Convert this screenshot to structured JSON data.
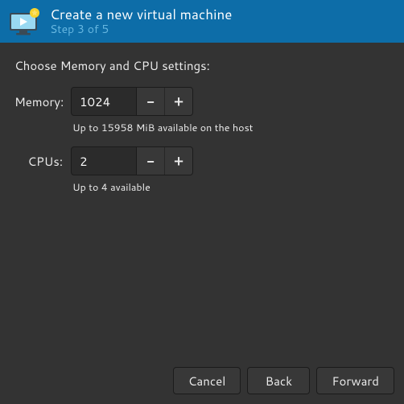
{
  "header": {
    "title": "Create a new virtual machine",
    "step": "Step 3 of 5"
  },
  "body": {
    "intro": "Choose Memory and CPU settings:",
    "memory": {
      "label": "Memory:",
      "value": "1024",
      "hint": "Up to 15958 MiB available on the host"
    },
    "cpus": {
      "label": "CPUs:",
      "value": "2",
      "hint": "Up to 4 available"
    },
    "spin_minus": "−",
    "spin_plus": "+"
  },
  "footer": {
    "cancel": "Cancel",
    "back": "Back",
    "forward": "Forward"
  }
}
